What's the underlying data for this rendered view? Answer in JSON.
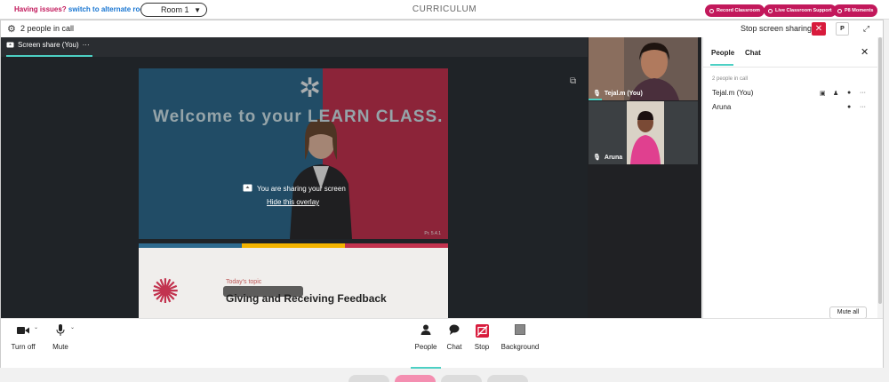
{
  "topbar": {
    "issue_prefix": "Having issues?",
    "issue_link": "switch to alternate room",
    "room": "Room 1",
    "title": "CURRICULUM",
    "pills": [
      "Record Classroom",
      "Live Classroom Support",
      "P8 Moments"
    ]
  },
  "call": {
    "people_count": "2 people in call",
    "stop_sharing": "Stop screen sharing",
    "p_label": "P"
  },
  "share": {
    "tab_label": "Screen share (You)",
    "tab_more": "···",
    "sharing_msg": "You are sharing your screen",
    "hide_overlay": "Hide this overlay",
    "slide1_text": "Welcome to your LEARN CLASS.",
    "slide1_page": "Pr. 5.4.1",
    "slide2_today": "Today's topic",
    "slide2_topic": "Giving and Receiving Feedback"
  },
  "tiles": [
    {
      "name": "Tejal.m (You)"
    },
    {
      "name": "Aruna"
    }
  ],
  "panel": {
    "tab_people": "People",
    "tab_chat": "Chat",
    "in_call": "2 people in call",
    "participants": [
      {
        "name": "Tejal.m (You)"
      },
      {
        "name": "Aruna"
      }
    ],
    "mute_all": "Mute all"
  },
  "controls": {
    "turn_off": "Turn off",
    "mute": "Mute",
    "people": "People",
    "chat": "Chat",
    "stop": "Stop",
    "background": "Background"
  },
  "colors": {
    "accent": "#4dd0c4",
    "danger": "#d81b3c",
    "brand": "#c2185b"
  }
}
